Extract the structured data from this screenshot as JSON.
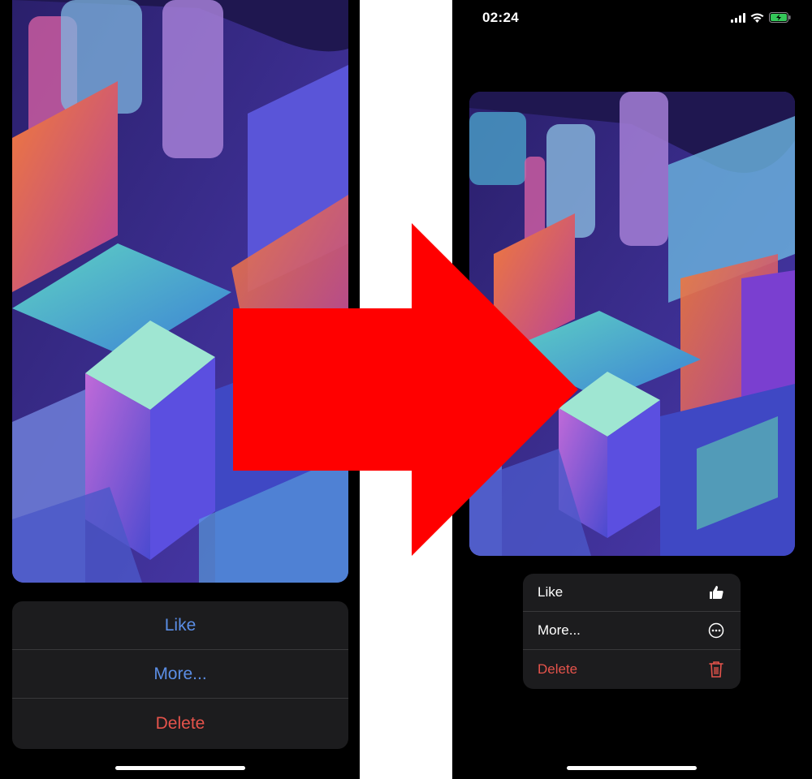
{
  "left_screen": {
    "action_sheet": {
      "items": [
        {
          "label": "Like",
          "style": "default"
        },
        {
          "label": "More...",
          "style": "default"
        },
        {
          "label": "Delete",
          "style": "destructive"
        }
      ]
    }
  },
  "right_screen": {
    "status_bar": {
      "time": "02:24",
      "icons": [
        "cellular-signal-icon",
        "wifi-icon",
        "battery-charging-icon"
      ]
    },
    "context_menu": {
      "items": [
        {
          "label": "Like",
          "icon": "thumbs-up-icon",
          "style": "default"
        },
        {
          "label": "More...",
          "icon": "ellipsis-circle-icon",
          "style": "default"
        },
        {
          "label": "Delete",
          "icon": "trash-icon",
          "style": "destructive"
        }
      ]
    }
  },
  "colors": {
    "arrow": "#ff0000",
    "action_tint": "#5b8ee6",
    "destructive": "#e5534b",
    "menu_bg": "#1c1c1e"
  }
}
